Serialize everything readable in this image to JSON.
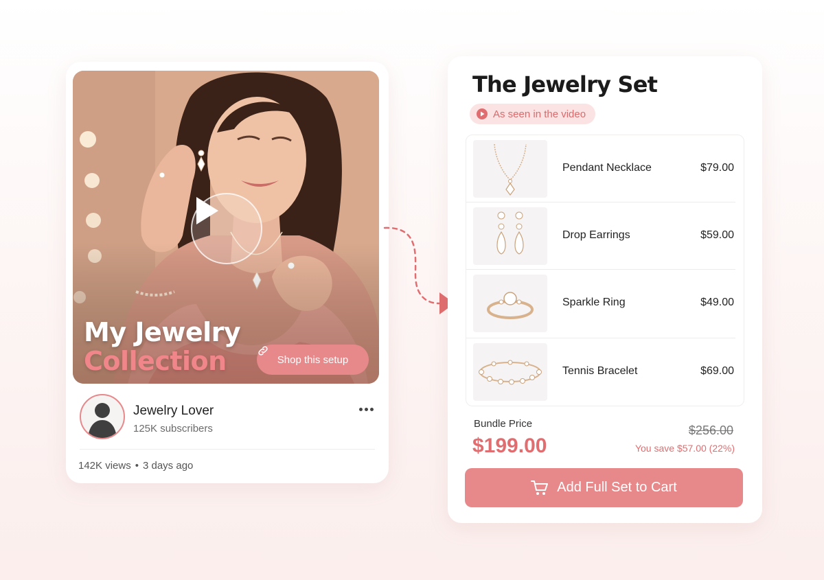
{
  "video": {
    "title_line1": "My Jewelry",
    "title_line2": "Collection",
    "shop_button": "Shop this setup",
    "channel_name": "Jewelry Lover",
    "subscribers": "125K subscribers",
    "views": "142K views",
    "separator": "•",
    "posted": "3 days ago"
  },
  "panel": {
    "title": "The Jewelry Set",
    "badge": "As seen in the video",
    "items": [
      {
        "name": "Pendant Necklace",
        "price": "$79.00",
        "icon": "necklace"
      },
      {
        "name": "Drop Earrings",
        "price": "$59.00",
        "icon": "earrings"
      },
      {
        "name": "Sparkle Ring",
        "price": "$49.00",
        "icon": "ring"
      },
      {
        "name": "Tennis Bracelet",
        "price": "$69.00",
        "icon": "bracelet"
      }
    ],
    "bundle_label": "Bundle Price",
    "bundle_price": "$199.00",
    "original_price": "$256.00",
    "savings": "You save $57.00 (22%)",
    "cart_button": "Add Full Set to Cart"
  },
  "colors": {
    "accent": "#e7898b",
    "accent_text": "#e06d6f",
    "badge_bg": "#fbe3e3"
  }
}
